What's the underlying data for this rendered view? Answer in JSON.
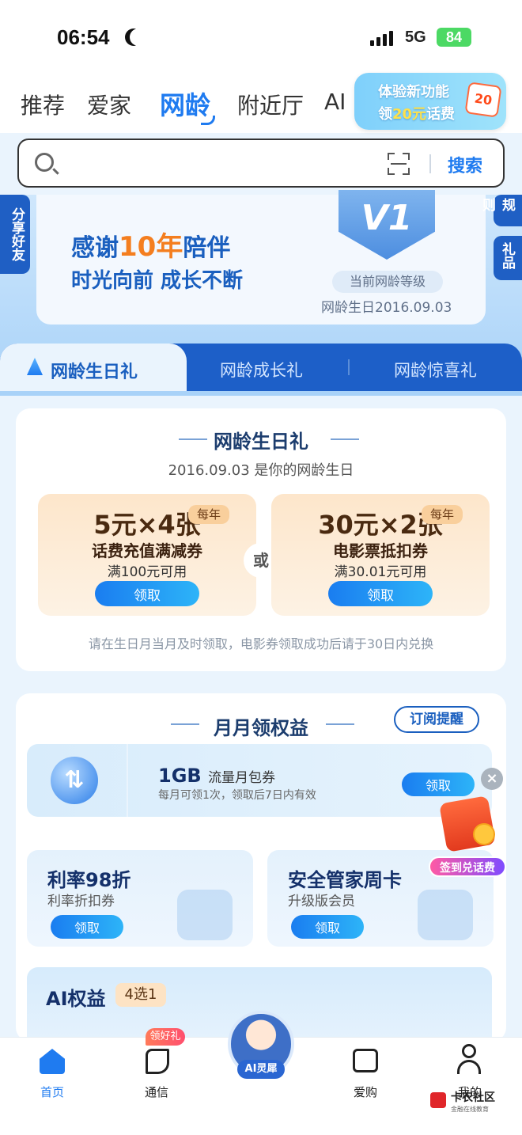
{
  "status": {
    "time": "06:54",
    "network": "5G",
    "battery": "84"
  },
  "topnav": {
    "tabs": [
      "推荐",
      "爱家",
      "网龄",
      "附近厅",
      "AI"
    ],
    "active": "网龄"
  },
  "promo": {
    "line1": "体验新功能",
    "line2_prefix": "领",
    "line2_amount": "20元",
    "line2_suffix": "话费",
    "coupon": "20"
  },
  "search": {
    "placeholder": "",
    "button": "搜索"
  },
  "hero": {
    "line1_a": "感谢",
    "line1_years": "10年",
    "line1_b": "陪伴",
    "line2": "时光向前 成长不断",
    "level": "V1",
    "level_label": "当前网龄等级",
    "birthday": "网龄生日2016.09.03",
    "share": "分享好友",
    "rules": "规则",
    "gift": "礼品"
  },
  "tabs": [
    "网龄生日礼",
    "网龄成长礼",
    "网龄惊喜礼"
  ],
  "birthday_panel": {
    "title": "网龄生日礼",
    "subtitle": "2016.09.03 是你的网龄生日",
    "coupons": [
      {
        "amount": "5元×4张",
        "tag": "每年",
        "name": "话费充值满减券",
        "condition": "满100元可用",
        "button": "领取"
      },
      {
        "amount": "30元×2张",
        "tag": "每年",
        "name": "电影票抵扣券",
        "condition": "满30.01元可用",
        "button": "领取"
      }
    ],
    "or": "或",
    "note": "请在生日月当月及时领取，电影券领取成功后请于30日内兑换"
  },
  "monthly": {
    "title": "月月领权益",
    "subscribe": "订阅提醒",
    "data_card": {
      "amount": "1GB",
      "name": "流量月包券",
      "note": "每月可领1次，领取后7日内有效",
      "button": "领取"
    },
    "cards": [
      {
        "title": "利率98折",
        "sub": "利率折扣券",
        "button": "领取"
      },
      {
        "title": "安全管家周卡",
        "sub": "升级版会员",
        "button": "领取"
      }
    ],
    "ai": {
      "title": "AI权益",
      "badge": "4选1"
    }
  },
  "float": {
    "label": "签到兑话费"
  },
  "bottom": {
    "items": [
      "首页",
      "通信",
      "爱购",
      "我的"
    ],
    "gift_tag": "领好礼",
    "ai_label": "AI灵犀"
  },
  "watermark": {
    "name": "卡农社区",
    "sub": "金融在线教育"
  },
  "colors": {
    "accent": "#1f7bf0",
    "brand_dark": "#1d5fc8",
    "highlight": "#f47e1f"
  }
}
